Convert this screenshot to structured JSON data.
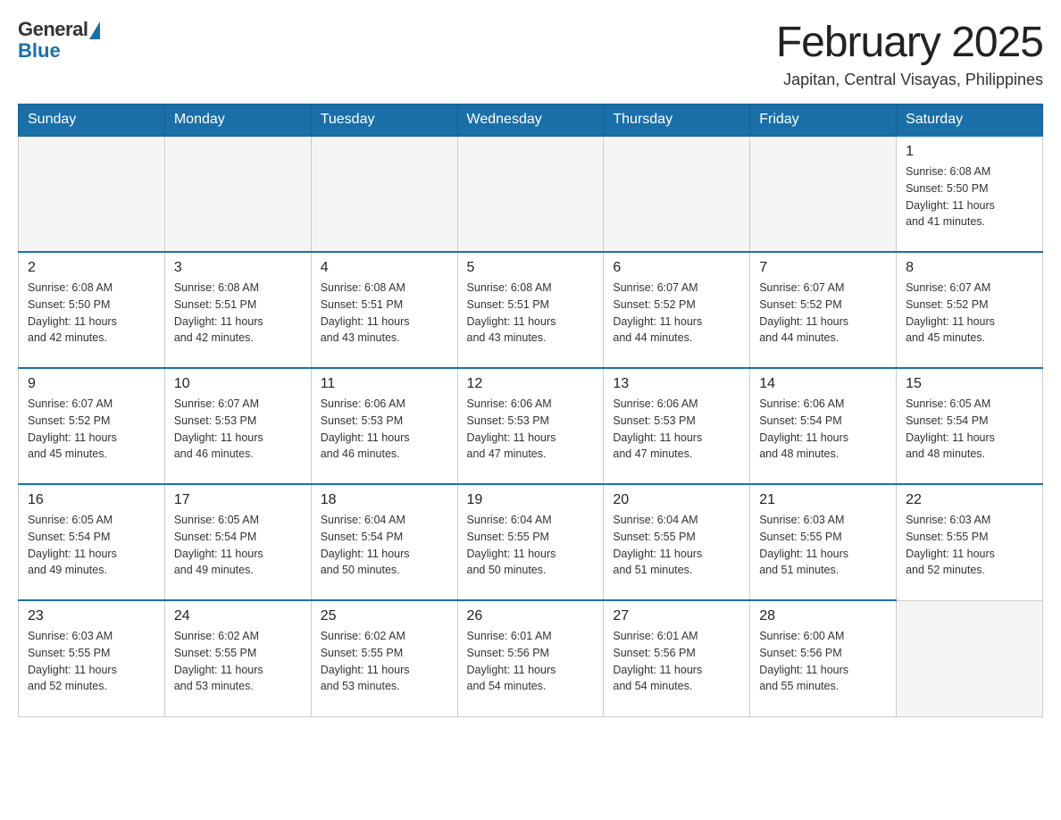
{
  "header": {
    "logo_general": "General",
    "logo_blue": "Blue",
    "month_title": "February 2025",
    "subtitle": "Japitan, Central Visayas, Philippines"
  },
  "days_of_week": [
    "Sunday",
    "Monday",
    "Tuesday",
    "Wednesday",
    "Thursday",
    "Friday",
    "Saturday"
  ],
  "weeks": [
    [
      {
        "day": "",
        "info": ""
      },
      {
        "day": "",
        "info": ""
      },
      {
        "day": "",
        "info": ""
      },
      {
        "day": "",
        "info": ""
      },
      {
        "day": "",
        "info": ""
      },
      {
        "day": "",
        "info": ""
      },
      {
        "day": "1",
        "info": "Sunrise: 6:08 AM\nSunset: 5:50 PM\nDaylight: 11 hours\nand 41 minutes."
      }
    ],
    [
      {
        "day": "2",
        "info": "Sunrise: 6:08 AM\nSunset: 5:50 PM\nDaylight: 11 hours\nand 42 minutes."
      },
      {
        "day": "3",
        "info": "Sunrise: 6:08 AM\nSunset: 5:51 PM\nDaylight: 11 hours\nand 42 minutes."
      },
      {
        "day": "4",
        "info": "Sunrise: 6:08 AM\nSunset: 5:51 PM\nDaylight: 11 hours\nand 43 minutes."
      },
      {
        "day": "5",
        "info": "Sunrise: 6:08 AM\nSunset: 5:51 PM\nDaylight: 11 hours\nand 43 minutes."
      },
      {
        "day": "6",
        "info": "Sunrise: 6:07 AM\nSunset: 5:52 PM\nDaylight: 11 hours\nand 44 minutes."
      },
      {
        "day": "7",
        "info": "Sunrise: 6:07 AM\nSunset: 5:52 PM\nDaylight: 11 hours\nand 44 minutes."
      },
      {
        "day": "8",
        "info": "Sunrise: 6:07 AM\nSunset: 5:52 PM\nDaylight: 11 hours\nand 45 minutes."
      }
    ],
    [
      {
        "day": "9",
        "info": "Sunrise: 6:07 AM\nSunset: 5:52 PM\nDaylight: 11 hours\nand 45 minutes."
      },
      {
        "day": "10",
        "info": "Sunrise: 6:07 AM\nSunset: 5:53 PM\nDaylight: 11 hours\nand 46 minutes."
      },
      {
        "day": "11",
        "info": "Sunrise: 6:06 AM\nSunset: 5:53 PM\nDaylight: 11 hours\nand 46 minutes."
      },
      {
        "day": "12",
        "info": "Sunrise: 6:06 AM\nSunset: 5:53 PM\nDaylight: 11 hours\nand 47 minutes."
      },
      {
        "day": "13",
        "info": "Sunrise: 6:06 AM\nSunset: 5:53 PM\nDaylight: 11 hours\nand 47 minutes."
      },
      {
        "day": "14",
        "info": "Sunrise: 6:06 AM\nSunset: 5:54 PM\nDaylight: 11 hours\nand 48 minutes."
      },
      {
        "day": "15",
        "info": "Sunrise: 6:05 AM\nSunset: 5:54 PM\nDaylight: 11 hours\nand 48 minutes."
      }
    ],
    [
      {
        "day": "16",
        "info": "Sunrise: 6:05 AM\nSunset: 5:54 PM\nDaylight: 11 hours\nand 49 minutes."
      },
      {
        "day": "17",
        "info": "Sunrise: 6:05 AM\nSunset: 5:54 PM\nDaylight: 11 hours\nand 49 minutes."
      },
      {
        "day": "18",
        "info": "Sunrise: 6:04 AM\nSunset: 5:54 PM\nDaylight: 11 hours\nand 50 minutes."
      },
      {
        "day": "19",
        "info": "Sunrise: 6:04 AM\nSunset: 5:55 PM\nDaylight: 11 hours\nand 50 minutes."
      },
      {
        "day": "20",
        "info": "Sunrise: 6:04 AM\nSunset: 5:55 PM\nDaylight: 11 hours\nand 51 minutes."
      },
      {
        "day": "21",
        "info": "Sunrise: 6:03 AM\nSunset: 5:55 PM\nDaylight: 11 hours\nand 51 minutes."
      },
      {
        "day": "22",
        "info": "Sunrise: 6:03 AM\nSunset: 5:55 PM\nDaylight: 11 hours\nand 52 minutes."
      }
    ],
    [
      {
        "day": "23",
        "info": "Sunrise: 6:03 AM\nSunset: 5:55 PM\nDaylight: 11 hours\nand 52 minutes."
      },
      {
        "day": "24",
        "info": "Sunrise: 6:02 AM\nSunset: 5:55 PM\nDaylight: 11 hours\nand 53 minutes."
      },
      {
        "day": "25",
        "info": "Sunrise: 6:02 AM\nSunset: 5:55 PM\nDaylight: 11 hours\nand 53 minutes."
      },
      {
        "day": "26",
        "info": "Sunrise: 6:01 AM\nSunset: 5:56 PM\nDaylight: 11 hours\nand 54 minutes."
      },
      {
        "day": "27",
        "info": "Sunrise: 6:01 AM\nSunset: 5:56 PM\nDaylight: 11 hours\nand 54 minutes."
      },
      {
        "day": "28",
        "info": "Sunrise: 6:00 AM\nSunset: 5:56 PM\nDaylight: 11 hours\nand 55 minutes."
      },
      {
        "day": "",
        "info": ""
      }
    ]
  ]
}
